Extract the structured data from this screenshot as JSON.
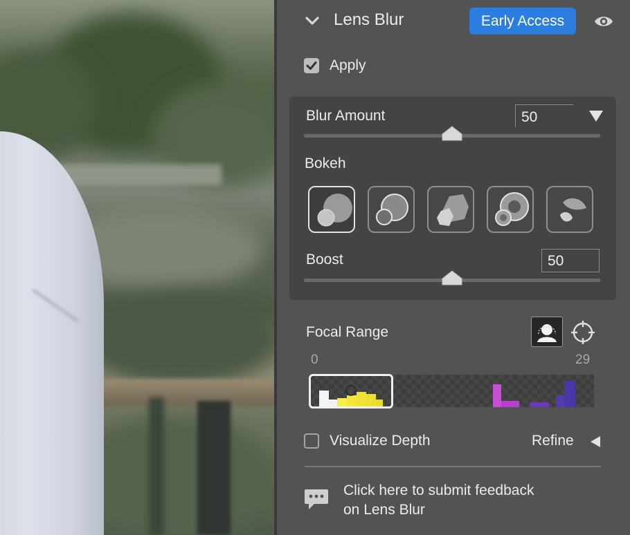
{
  "panel": {
    "title": "Lens Blur",
    "badge": "Early Access",
    "apply": {
      "label": "Apply",
      "checked": true
    },
    "blur_amount": {
      "label": "Blur Amount",
      "value": "50",
      "slider_fraction": 0.5
    },
    "bokeh": {
      "label": "Bokeh",
      "shapes": [
        "bokeh-circle",
        "bokeh-ring",
        "bokeh-polygon",
        "bokeh-donut",
        "bokeh-cat-eye"
      ],
      "selected_index": 0
    },
    "boost": {
      "label": "Boost",
      "value": "50",
      "slider_fraction": 0.5
    },
    "focal_range": {
      "label": "Focal Range",
      "min": "0",
      "max": "29",
      "icons": [
        "subject-portrait-icon",
        "target-icon"
      ]
    },
    "visualize_depth": {
      "label": "Visualize Depth",
      "checked": false
    },
    "refine": {
      "label": "Refine"
    },
    "feedback": {
      "line1": "Click here to submit feedback",
      "line2": "on Lens Blur"
    }
  },
  "colors": {
    "accent": "#2b7ee0",
    "panel_bg": "#535353",
    "group_bg": "#444444",
    "histogram_near": "#f2e53c",
    "histogram_mid": "#c23fd0",
    "histogram_far": "#4a3bb0"
  }
}
